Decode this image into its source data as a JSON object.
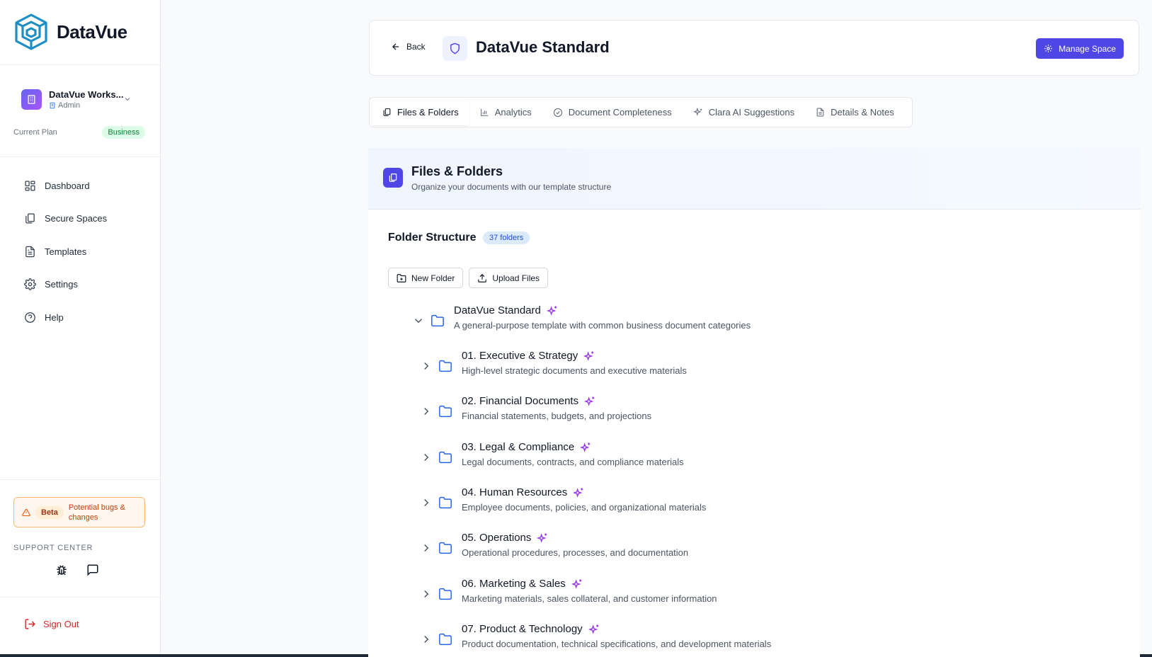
{
  "app": {
    "name": "DataVue"
  },
  "workspace": {
    "name": "DataVue Works...",
    "role": "Admin"
  },
  "plan": {
    "label": "Current Plan",
    "value": "Business"
  },
  "nav": [
    {
      "label": "Dashboard",
      "icon": "dashboard-icon"
    },
    {
      "label": "Secure Spaces",
      "icon": "copy-icon"
    },
    {
      "label": "Templates",
      "icon": "file-text-icon"
    },
    {
      "label": "Settings",
      "icon": "gear-icon"
    },
    {
      "label": "Help",
      "icon": "help-circle-icon"
    }
  ],
  "beta": {
    "pill": "Beta",
    "text": "Potential bugs & changes"
  },
  "support": {
    "title": "SUPPORT CENTER"
  },
  "signout": {
    "label": "Sign Out"
  },
  "header": {
    "back": "Back",
    "title": "DataVue Standard",
    "manage": "Manage Space"
  },
  "tabs": [
    {
      "label": "Files & Folders",
      "active": true
    },
    {
      "label": "Analytics"
    },
    {
      "label": "Document Completeness"
    },
    {
      "label": "Clara AI Suggestions"
    },
    {
      "label": "Details & Notes"
    }
  ],
  "section": {
    "title": "Files & Folders",
    "subtitle": "Organize your documents with our template structure"
  },
  "folders": {
    "title": "Folder Structure",
    "count": "37 folders",
    "new_folder": "New Folder",
    "upload": "Upload Files",
    "root": {
      "name": "DataVue Standard",
      "desc": "A general-purpose template with common business document categories"
    },
    "children": [
      {
        "name": "01. Executive & Strategy",
        "desc": "High-level strategic documents and executive materials"
      },
      {
        "name": "02. Financial Documents",
        "desc": "Financial statements, budgets, and projections"
      },
      {
        "name": "03. Legal & Compliance",
        "desc": "Legal documents, contracts, and compliance materials"
      },
      {
        "name": "04. Human Resources",
        "desc": "Employee documents, policies, and organizational materials"
      },
      {
        "name": "05. Operations",
        "desc": "Operational procedures, processes, and documentation"
      },
      {
        "name": "06. Marketing & Sales",
        "desc": "Marketing materials, sales collateral, and customer information"
      },
      {
        "name": "07. Product & Technology",
        "desc": "Product documentation, technical specifications, and development materials"
      }
    ]
  },
  "colors": {
    "accent": "#4f46e5",
    "folder": "#2563eb",
    "sparkle": "#9333ea",
    "danger": "#dc2626"
  }
}
